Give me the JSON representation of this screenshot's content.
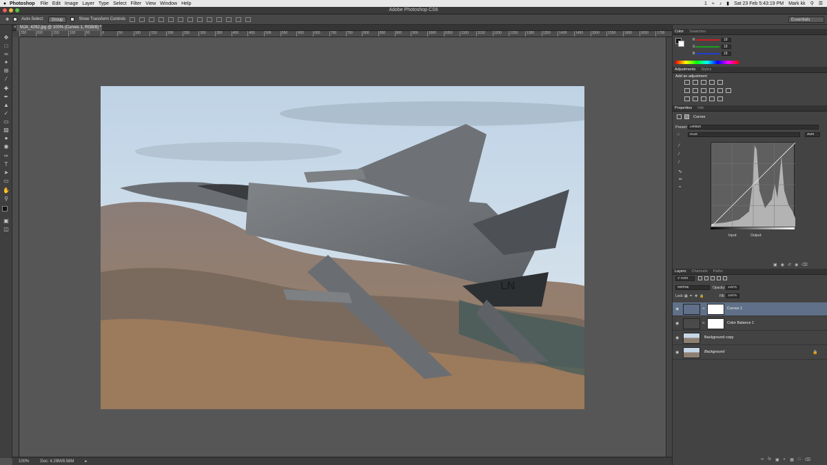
{
  "menubar": {
    "apple": "",
    "items": [
      "Photoshop",
      "File",
      "Edit",
      "Image",
      "Layer",
      "Type",
      "Select",
      "Filter",
      "View",
      "Window",
      "Help"
    ],
    "status_right": {
      "badge": "1",
      "datetime": "Sat 23 Feb  5:43:19 PM",
      "user": "Mark kk"
    }
  },
  "window": {
    "title": "Adobe Photoshop CS6",
    "traffic_colors": [
      "#ee5b54",
      "#e9b73a",
      "#57bf43"
    ]
  },
  "options_bar": {
    "auto_select_label": "Auto-Select:",
    "auto_select_value": "Group",
    "transform_label": "Show Transform Controls",
    "workspace": "Essentials"
  },
  "document": {
    "tab_label": "MJA_4292.jpg @ 100% (Curves 1, RGB/8) *",
    "ruler_ticks": [
      "250",
      "200",
      "150",
      "100",
      "50",
      "0",
      "50",
      "100",
      "150",
      "200",
      "250",
      "300",
      "350",
      "400",
      "450",
      "500",
      "550",
      "600",
      "650",
      "700",
      "750",
      "800",
      "850",
      "900",
      "950",
      "1000",
      "1050",
      "1100",
      "1150",
      "1200",
      "1250",
      "1300",
      "1350",
      "1400",
      "1450",
      "1500",
      "1550",
      "1600",
      "1650",
      "1700"
    ]
  },
  "status_bar": {
    "zoom": "100%",
    "doc_size": "Doc: 4.29M/8.58M"
  },
  "color_panel": {
    "tabs": [
      "Color",
      "Swatches"
    ],
    "channels": [
      {
        "label": "R",
        "value": "18",
        "color": "#d21e1e"
      },
      {
        "label": "G",
        "value": "18",
        "color": "#1ea01e"
      },
      {
        "label": "B",
        "value": "18",
        "color": "#1e3cd2"
      }
    ]
  },
  "adjustments_panel": {
    "tabs": [
      "Adjustments",
      "Styles"
    ],
    "heading": "Add an adjustment"
  },
  "properties_panel": {
    "tabs": [
      "Properties",
      "Info"
    ],
    "kind": "Curves",
    "preset_label": "Preset:",
    "preset_value": "Default",
    "channel_value": "RGB",
    "auto_label": "Auto",
    "input_label": "Input:",
    "output_label": "Output:"
  },
  "layers_panel": {
    "tabs": [
      "Layers",
      "Channels",
      "Paths"
    ],
    "filter_label": "Kind",
    "blend_mode": "Normal",
    "opacity_label": "Opacity:",
    "opacity_value": "100%",
    "lock_label": "Lock:",
    "fill_label": "Fill:",
    "fill_value": "100%",
    "layers": [
      {
        "name": "Curves 1",
        "selected": true
      },
      {
        "name": "Color Balance 1",
        "selected": false
      },
      {
        "name": "Background copy",
        "selected": false
      },
      {
        "name": "Background",
        "selected": false
      }
    ]
  },
  "tools": [
    "move-tool",
    "marquee-tool",
    "lasso-tool",
    "quick-select-tool",
    "crop-tool",
    "eyedropper-tool",
    "healing-tool",
    "brush-tool",
    "stamp-tool",
    "history-brush-tool",
    "eraser-tool",
    "gradient-tool",
    "blur-tool",
    "dodge-tool",
    "pen-tool",
    "type-tool",
    "path-select-tool",
    "shape-tool",
    "hand-tool",
    "zoom-tool"
  ]
}
